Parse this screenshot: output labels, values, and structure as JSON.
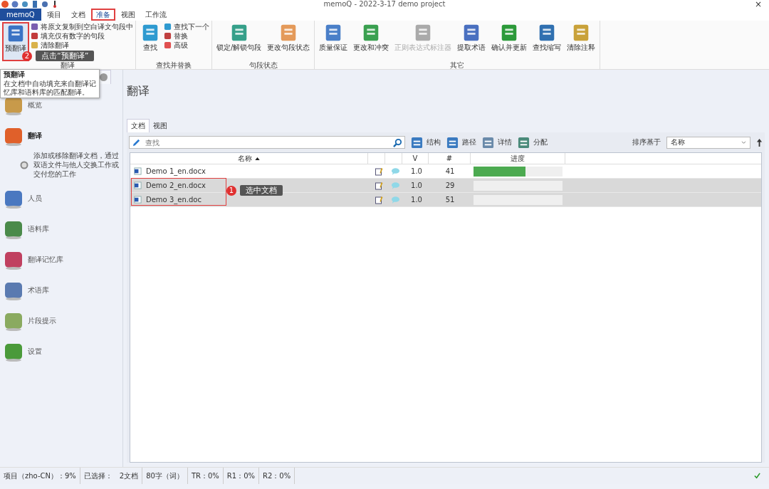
{
  "window": {
    "title": "memoQ - 2022-3-17 demo project",
    "close": "×"
  },
  "menu": [
    {
      "label": "memoQ",
      "kind": "app",
      "selected": false
    },
    {
      "label": "项目",
      "kind": "tab",
      "selected": false
    },
    {
      "label": "文档",
      "kind": "tab",
      "selected": false
    },
    {
      "label": "准备",
      "kind": "tab",
      "selected": true
    },
    {
      "label": "视图",
      "kind": "tab",
      "selected": false
    },
    {
      "label": "工作流",
      "kind": "tab",
      "selected": false
    }
  ],
  "ribbon": [
    {
      "label": "翻译",
      "items": [
        {
          "label": "预翻译",
          "kind": "large",
          "disabled": false,
          "highlighted": true
        },
        {
          "label": "将原文复制到空白译文句段中",
          "kind": "small",
          "disabled": false,
          "highlighted": false
        },
        {
          "label": "填充仅有数字的句段",
          "kind": "small",
          "disabled": false,
          "highlighted": false
        },
        {
          "label": "清除翻译",
          "kind": "small",
          "disabled": false,
          "highlighted": false
        }
      ]
    },
    {
      "label": "查找并替换",
      "items": [
        {
          "label": "查找",
          "kind": "large",
          "disabled": false,
          "highlighted": false
        },
        {
          "label": "查找下一个",
          "kind": "small",
          "disabled": false,
          "highlighted": false
        },
        {
          "label": "替换",
          "kind": "small",
          "disabled": false,
          "highlighted": false
        },
        {
          "label": "高级",
          "kind": "small",
          "disabled": false,
          "highlighted": false
        }
      ]
    },
    {
      "label": "句段状态",
      "items": [
        {
          "label": "锁定/解锁句段",
          "kind": "large",
          "disabled": false,
          "highlighted": false
        },
        {
          "label": "更改句段状态",
          "kind": "large",
          "disabled": false,
          "highlighted": false
        }
      ]
    },
    {
      "label": "其它",
      "items": [
        {
          "label": "质量保证",
          "kind": "large",
          "disabled": false,
          "highlighted": false
        },
        {
          "label": "更改和冲突",
          "kind": "large",
          "disabled": false,
          "highlighted": false
        },
        {
          "label": "正则表达式标注器",
          "kind": "large",
          "disabled": true,
          "highlighted": false
        },
        {
          "label": "提取术语",
          "kind": "large",
          "disabled": false,
          "highlighted": false
        },
        {
          "label": "确认并更新",
          "kind": "large",
          "disabled": false,
          "highlighted": false
        },
        {
          "label": "查找缩写",
          "kind": "large",
          "disabled": false,
          "highlighted": false
        },
        {
          "label": "清除注释",
          "kind": "large",
          "disabled": false,
          "highlighted": false
        }
      ]
    }
  ],
  "tooltip": {
    "title": "预翻译",
    "text": "在文档中自动填充来自翻译记忆库和语料库的匹配翻译。"
  },
  "sidebar": [
    {
      "label": "概览",
      "selected": false
    },
    {
      "label": "翻译",
      "selected": true,
      "description": "添加或移除翻译文档，通过双语文件与他人交换工作或交付您的工作"
    },
    {
      "label": "人员",
      "selected": false
    },
    {
      "label": "语料库",
      "selected": false
    },
    {
      "label": "翻译记忆库",
      "selected": false
    },
    {
      "label": "术语库",
      "selected": false
    },
    {
      "label": "片段提示",
      "selected": false
    },
    {
      "label": "设置",
      "selected": false
    }
  ],
  "heading": "翻译",
  "subtabs": [
    {
      "label": "文档",
      "selected": true
    },
    {
      "label": "视图",
      "selected": false
    }
  ],
  "toolbar": {
    "search": {
      "placeholder": "查找"
    },
    "buttons": [
      "结构",
      "路径",
      "详情",
      "分配"
    ],
    "sort_label": "排序基于",
    "sort_value": "名称"
  },
  "table": {
    "columns": [
      "名称",
      "V",
      "#",
      "进度"
    ],
    "rows": [
      {
        "name": "Demo 1_en.docx",
        "v": "1.0",
        "count": "41",
        "level": 0.58,
        "selected": false
      },
      {
        "name": "Demo 2_en.docx",
        "v": "1.0",
        "count": "29",
        "level": 0,
        "selected": true
      },
      {
        "name": "Demo 3_en.doc",
        "v": "1.0",
        "count": "51",
        "level": 0,
        "selected": true
      }
    ]
  },
  "annotations": [
    {
      "kind": "ribbon",
      "number": "2",
      "text": "点击“预翻译”"
    },
    {
      "kind": "rows",
      "number": "1",
      "text": "选中文档"
    }
  ],
  "status_bar": [
    "项目（zho-CN）：9%",
    "已选择：",
    "2文档",
    "80字（词）",
    "TR：0%",
    "R1：0%",
    "R2：0%"
  ]
}
